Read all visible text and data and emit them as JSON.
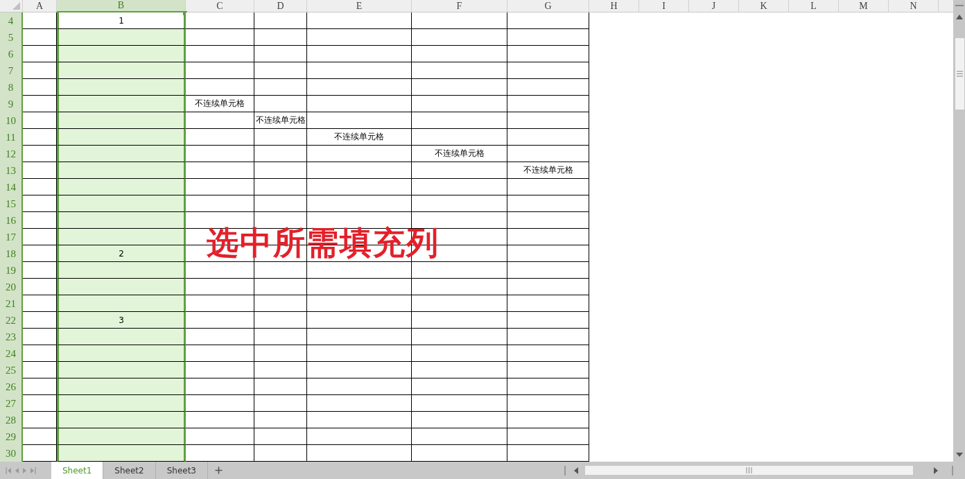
{
  "columns": [
    {
      "label": "A",
      "selected": false,
      "bordered": true
    },
    {
      "label": "B",
      "selected": true,
      "bordered": true
    },
    {
      "label": "C",
      "selected": false,
      "bordered": true
    },
    {
      "label": "D",
      "selected": false,
      "bordered": true
    },
    {
      "label": "E",
      "selected": false,
      "bordered": true
    },
    {
      "label": "F",
      "selected": false,
      "bordered": true
    },
    {
      "label": "G",
      "selected": false,
      "bordered": true
    },
    {
      "label": "H",
      "selected": false,
      "bordered": false
    },
    {
      "label": "I",
      "selected": false,
      "bordered": false
    },
    {
      "label": "J",
      "selected": false,
      "bordered": false
    },
    {
      "label": "K",
      "selected": false,
      "bordered": false
    },
    {
      "label": "L",
      "selected": false,
      "bordered": false
    },
    {
      "label": "M",
      "selected": false,
      "bordered": false
    },
    {
      "label": "N",
      "selected": false,
      "bordered": false
    }
  ],
  "rows": [
    {
      "label": "4",
      "cells": [
        null,
        {
          "text": "1",
          "active": true
        }
      ]
    },
    {
      "label": "5"
    },
    {
      "label": "6"
    },
    {
      "label": "7"
    },
    {
      "label": "8"
    },
    {
      "label": "9",
      "cells": [
        null,
        null,
        {
          "text": "不连续单元格",
          "active": false
        }
      ]
    },
    {
      "label": "10",
      "cells": [
        null,
        null,
        null,
        {
          "text": "不连续单元格",
          "active": false
        }
      ]
    },
    {
      "label": "11",
      "cells": [
        null,
        null,
        null,
        null,
        {
          "text": "不连续单元格",
          "active": false
        }
      ]
    },
    {
      "label": "12",
      "cells": [
        null,
        null,
        null,
        null,
        null,
        {
          "text": "不连续单元格",
          "active": false
        }
      ]
    },
    {
      "label": "13",
      "cells": [
        null,
        null,
        null,
        null,
        null,
        null,
        {
          "text": "不连续单元格",
          "active": false
        }
      ]
    },
    {
      "label": "14"
    },
    {
      "label": "15"
    },
    {
      "label": "16"
    },
    {
      "label": "17"
    },
    {
      "label": "18",
      "cells": [
        null,
        {
          "text": "2",
          "active": false
        }
      ]
    },
    {
      "label": "19"
    },
    {
      "label": "20"
    },
    {
      "label": "21"
    },
    {
      "label": "22",
      "cells": [
        null,
        {
          "text": "3",
          "active": false
        }
      ]
    },
    {
      "label": "23"
    },
    {
      "label": "24"
    },
    {
      "label": "25"
    },
    {
      "label": "26"
    },
    {
      "label": "27"
    },
    {
      "label": "28"
    },
    {
      "label": "29"
    },
    {
      "label": "30"
    }
  ],
  "annotation": "选中所需填充列",
  "sheet_tabs": [
    {
      "label": "Sheet1",
      "selected": true
    },
    {
      "label": "Sheet2",
      "selected": false
    },
    {
      "label": "Sheet3",
      "selected": false
    }
  ]
}
